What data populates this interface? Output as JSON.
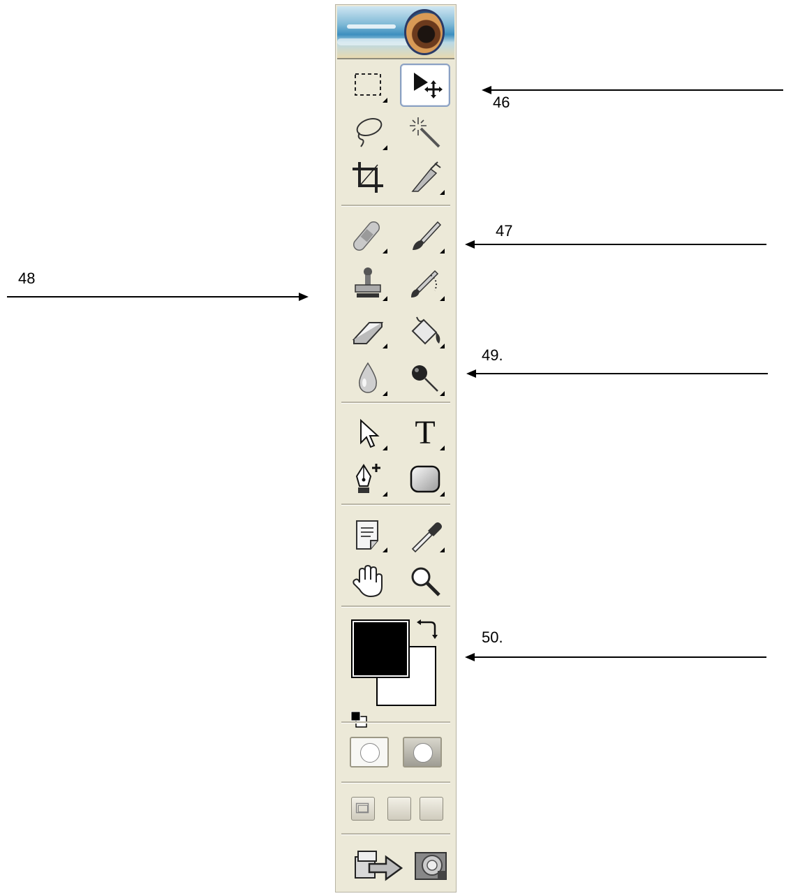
{
  "toolbox": {
    "rows": [
      [
        {
          "name": "rectangular-marquee-icon",
          "active": false,
          "flyout": true
        },
        {
          "name": "move-icon",
          "active": true,
          "flyout": false
        }
      ],
      [
        {
          "name": "lasso-icon",
          "active": false,
          "flyout": true
        },
        {
          "name": "magic-wand-icon",
          "active": false,
          "flyout": false
        }
      ],
      [
        {
          "name": "crop-icon",
          "active": false,
          "flyout": false
        },
        {
          "name": "slice-icon",
          "active": false,
          "flyout": true
        }
      ],
      [
        {
          "name": "healing-brush-icon",
          "active": false,
          "flyout": true
        },
        {
          "name": "brush-icon",
          "active": false,
          "flyout": true
        }
      ],
      [
        {
          "name": "clone-stamp-icon",
          "active": false,
          "flyout": true
        },
        {
          "name": "history-brush-icon",
          "active": false,
          "flyout": true
        }
      ],
      [
        {
          "name": "eraser-icon",
          "active": false,
          "flyout": true
        },
        {
          "name": "paint-bucket-icon",
          "active": false,
          "flyout": true
        }
      ],
      [
        {
          "name": "blur-icon",
          "active": false,
          "flyout": true
        },
        {
          "name": "dodge-icon",
          "active": false,
          "flyout": true
        }
      ],
      [
        {
          "name": "path-selection-icon",
          "active": false,
          "flyout": true
        },
        {
          "name": "type-icon",
          "active": false,
          "flyout": true
        }
      ],
      [
        {
          "name": "pen-icon",
          "active": false,
          "flyout": true
        },
        {
          "name": "shape-icon",
          "active": false,
          "flyout": true
        }
      ],
      [
        {
          "name": "notes-icon",
          "active": false,
          "flyout": true
        },
        {
          "name": "eyedropper-icon",
          "active": false,
          "flyout": true
        }
      ],
      [
        {
          "name": "hand-icon",
          "active": false,
          "flyout": false
        },
        {
          "name": "zoom-icon",
          "active": false,
          "flyout": false
        }
      ]
    ],
    "type_glyph": "T",
    "foreground_color": "#000000",
    "background_color": "#ffffff",
    "panel_color": "#ece9d8"
  },
  "annotations": {
    "label_46": "46",
    "label_47": "47",
    "label_48": "48",
    "label_49": "49.",
    "label_50": "50."
  }
}
